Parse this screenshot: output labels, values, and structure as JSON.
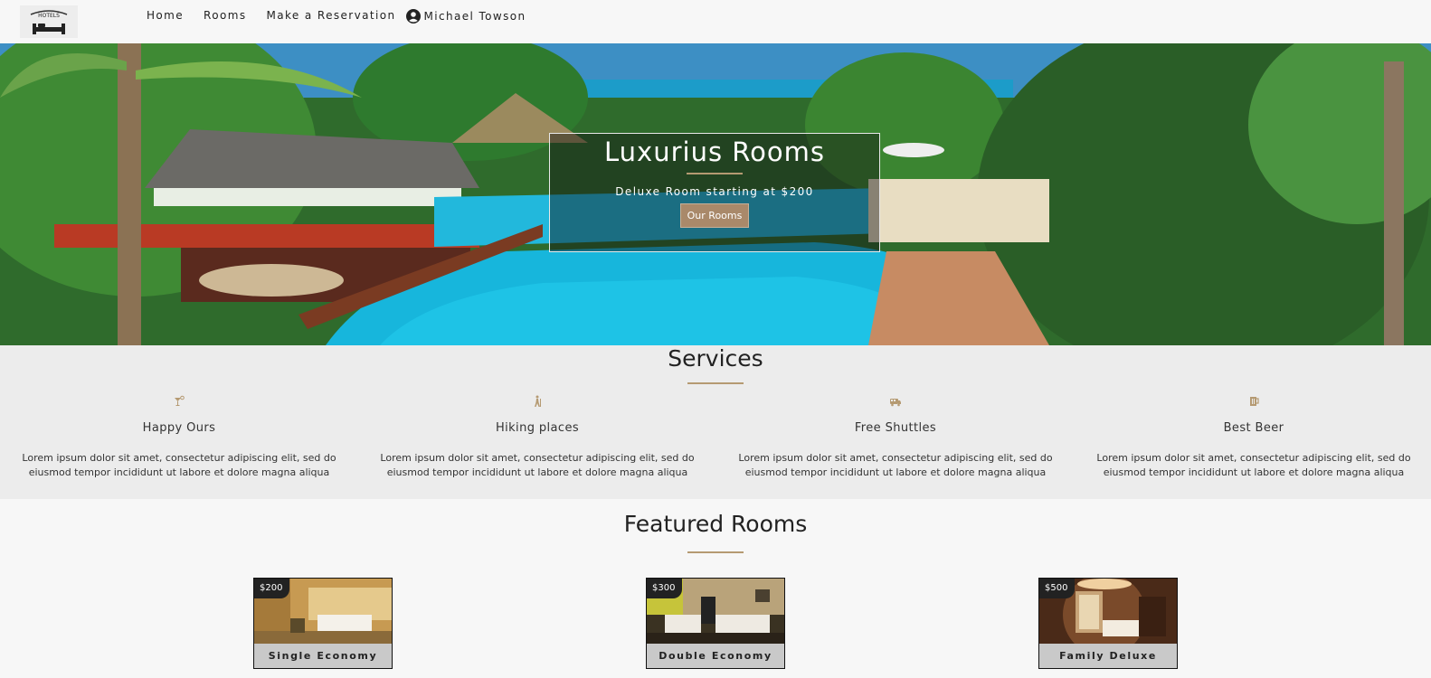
{
  "nav": {
    "logo_text": "HOTELS",
    "links": [
      "Home",
      "Rooms",
      "Make a Reservation"
    ],
    "user_name": "Michael Towson"
  },
  "hero": {
    "title": "Luxurius Rooms",
    "subtitle": "Deluxe Room starting at $200",
    "button_label": "Our Rooms"
  },
  "services": {
    "title": "Services",
    "items": [
      {
        "icon": "cocktail-icon",
        "name": "Happy Ours",
        "text": "Lorem ipsum dolor sit amet, consectetur adipiscing elit, sed do eiusmod tempor incididunt ut labore et dolore magna aliqua"
      },
      {
        "icon": "hiking-icon",
        "name": "Hiking places",
        "text": "Lorem ipsum dolor sit amet, consectetur adipiscing elit, sed do eiusmod tempor incididunt ut labore et dolore magna aliqua"
      },
      {
        "icon": "shuttle-icon",
        "name": "Free Shuttles",
        "text": "Lorem ipsum dolor sit amet, consectetur adipiscing elit, sed do eiusmod tempor incididunt ut labore et dolore magna aliqua"
      },
      {
        "icon": "beer-icon",
        "name": "Best Beer",
        "text": "Lorem ipsum dolor sit amet, consectetur adipiscing elit, sed do eiusmod tempor incididunt ut labore et dolore magna aliqua"
      }
    ]
  },
  "featured": {
    "title": "Featured Rooms",
    "rooms": [
      {
        "price": "$200",
        "name": "Single Economy"
      },
      {
        "price": "$300",
        "name": "Double Economy"
      },
      {
        "price": "$500",
        "name": "Family Deluxe"
      }
    ]
  },
  "colors": {
    "accent": "#b59a72",
    "button": "#a9896a",
    "page_bg": "#f7f7f7",
    "services_bg": "#ececec"
  }
}
